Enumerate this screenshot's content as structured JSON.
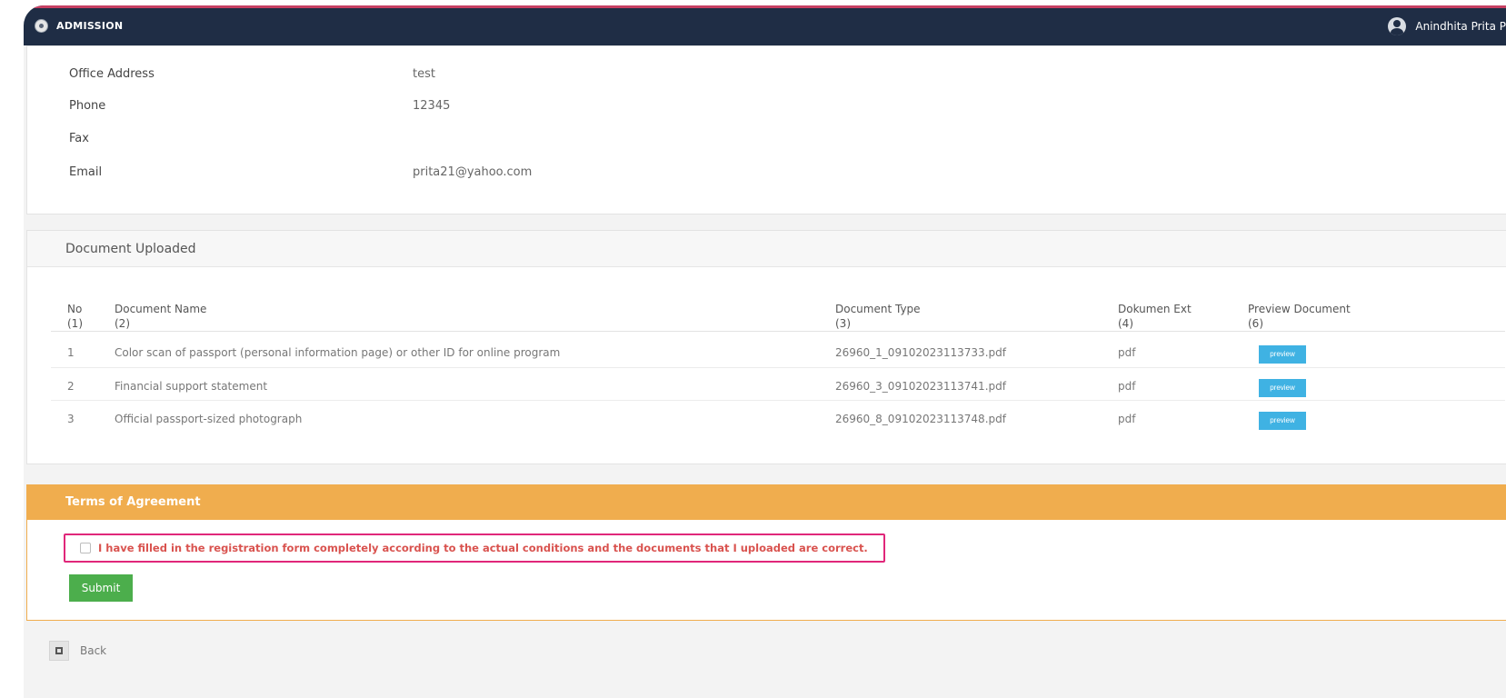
{
  "header": {
    "app_title": "ADMISSION",
    "user_name": "Anindhita Prita P"
  },
  "contact_info": {
    "rows": [
      {
        "label": "Office Address",
        "value": "test"
      },
      {
        "label": "Phone",
        "value": "12345"
      },
      {
        "label": "Fax",
        "value": ""
      },
      {
        "label": "Email",
        "value": "prita21@yahoo.com"
      }
    ]
  },
  "documents": {
    "title": "Document Uploaded",
    "columns": [
      {
        "label": "No",
        "index": "(1)"
      },
      {
        "label": "Document Name",
        "index": "(2)"
      },
      {
        "label": "Document Type",
        "index": "(3)"
      },
      {
        "label": "Dokumen Ext",
        "index": "(4)"
      },
      {
        "label": "Preview Document",
        "index": "(6)"
      }
    ],
    "rows": [
      {
        "no": "1",
        "name": "Color scan of passport (personal information page) or other ID for online program",
        "type": "26960_1_09102023113733.pdf",
        "ext": "pdf",
        "preview": "preview"
      },
      {
        "no": "2",
        "name": "Financial support statement",
        "type": "26960_3_09102023113741.pdf",
        "ext": "pdf",
        "preview": "preview"
      },
      {
        "no": "3",
        "name": "Official passport-sized photograph",
        "type": "26960_8_09102023113748.pdf",
        "ext": "pdf",
        "preview": "preview"
      }
    ]
  },
  "terms": {
    "title": "Terms of Agreement",
    "agreement_text": "I have filled in the registration form completely according to the actual conditions and the documents that I uploaded are correct.",
    "agreement_checked": false,
    "submit_label": "Submit"
  },
  "footer": {
    "back_label": "Back"
  },
  "colors": {
    "topbar": "#1f2d45",
    "terms_header": "#f0ad4e",
    "preview_button": "#3fb2e3",
    "submit_button": "#4cae4c",
    "agreement_text": "#d9534f",
    "highlight_border": "#e0277a"
  }
}
